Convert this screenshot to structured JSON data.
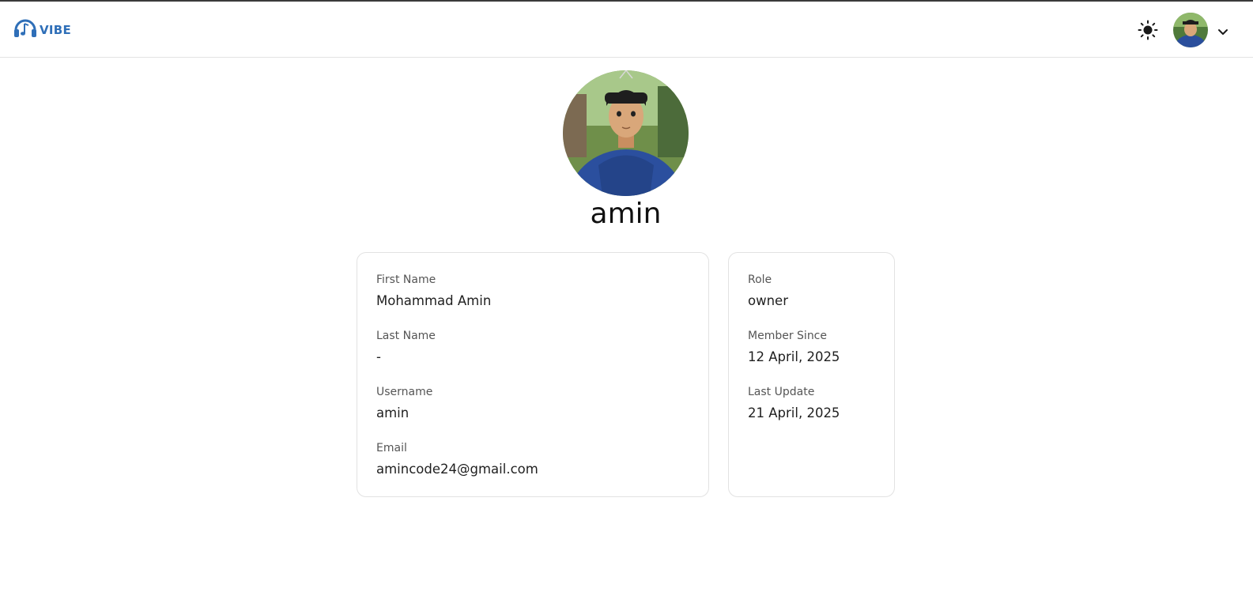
{
  "app": {
    "name": "VIBE",
    "accent": "#2f6fb8"
  },
  "header": {
    "logo_icon": "headphones-music-icon",
    "theme_icon": "sun-icon",
    "menu_icon": "chevron-down-icon"
  },
  "profile": {
    "username": "amin",
    "details": [
      {
        "label": "First Name",
        "value": "Mohammad Amin"
      },
      {
        "label": "Last Name",
        "value": "-"
      },
      {
        "label": "Username",
        "value": "amin"
      },
      {
        "label": "Email",
        "value": "amincode24@gmail.com"
      }
    ],
    "meta": [
      {
        "label": "Role",
        "value": "owner"
      },
      {
        "label": "Member Since",
        "value": "12 April, 2025"
      },
      {
        "label": "Last Update",
        "value": "21 April, 2025"
      }
    ]
  }
}
